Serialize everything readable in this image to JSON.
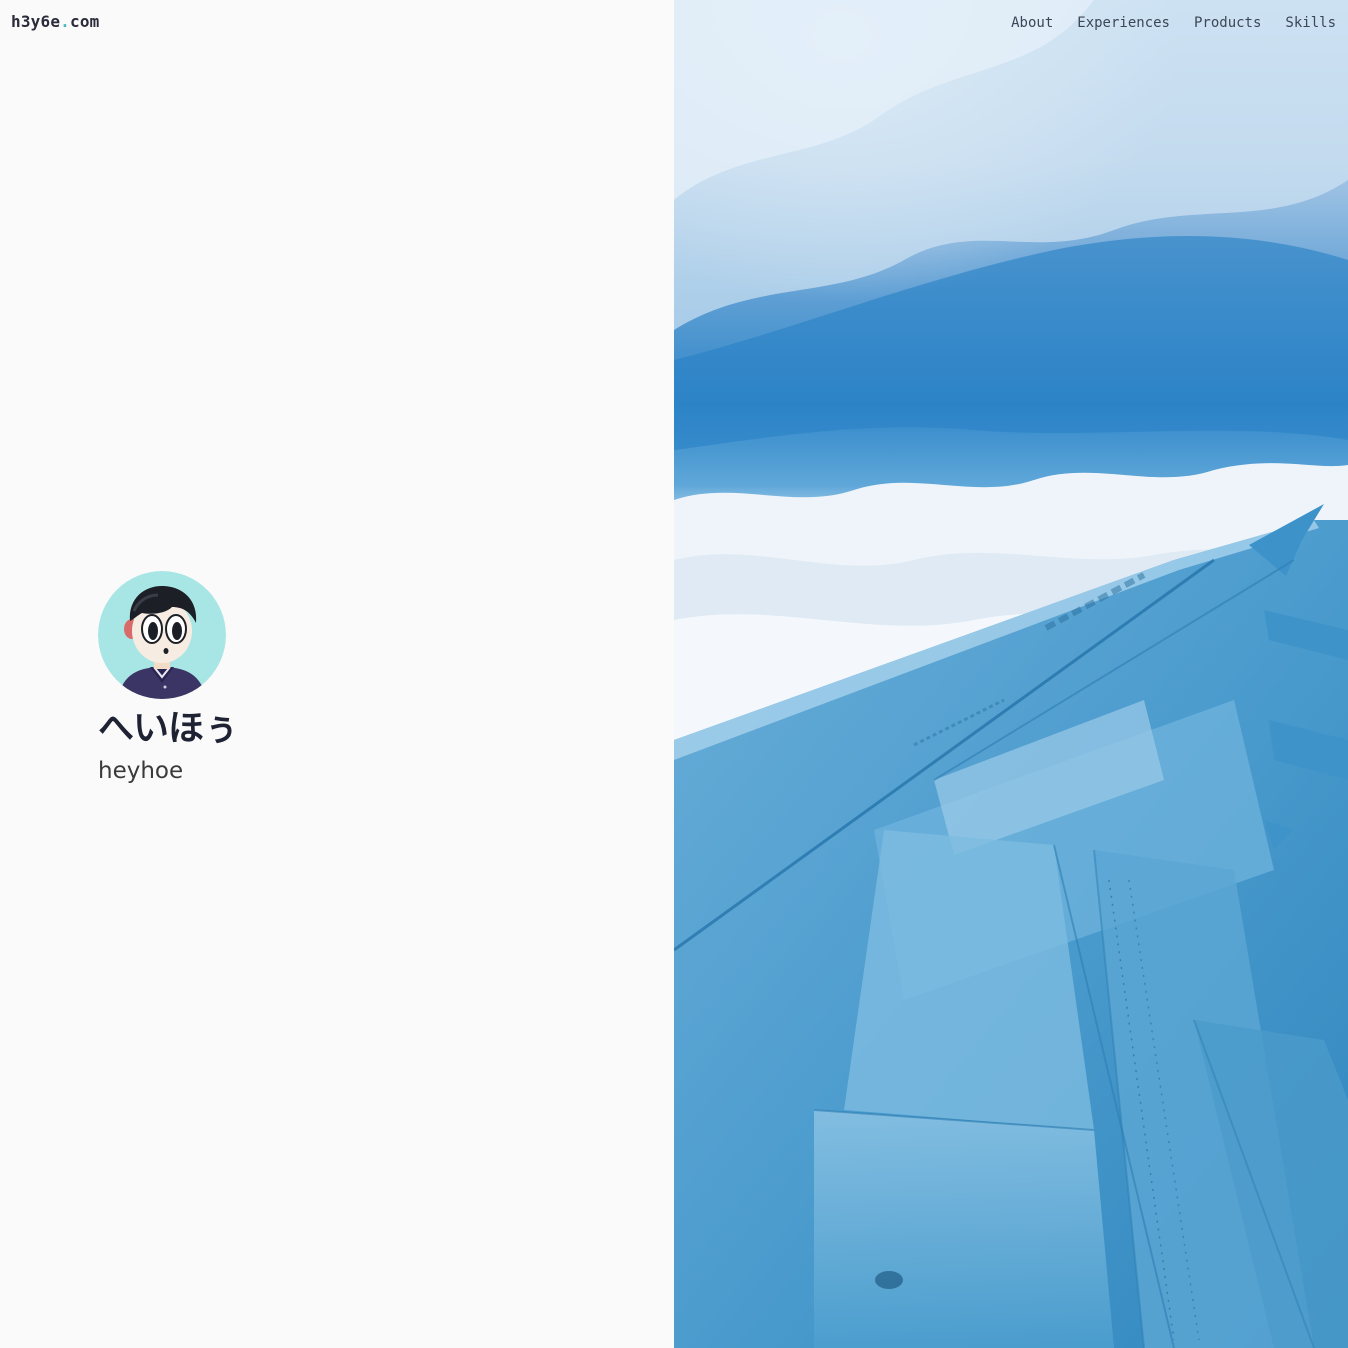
{
  "site": {
    "logo_main": "h3y6e",
    "logo_dot": ".",
    "logo_tld": "com"
  },
  "nav": {
    "items": [
      {
        "label": "About"
      },
      {
        "label": "Experiences"
      },
      {
        "label": "Products"
      },
      {
        "label": "Skills"
      }
    ]
  },
  "profile": {
    "name_jp": "へいほぅ",
    "name_en": "heyhoe"
  },
  "colors": {
    "background": "#fafafa",
    "avatar_bg": "#a8e6e6",
    "text_dark": "#1f2233",
    "logo_dot": "#4fb6c4",
    "sky_blue": "#2d8fc4"
  },
  "icons": {
    "avatar": "cartoon-avatar-illustration",
    "hero": "airplane-wing-over-clouds-photo"
  }
}
